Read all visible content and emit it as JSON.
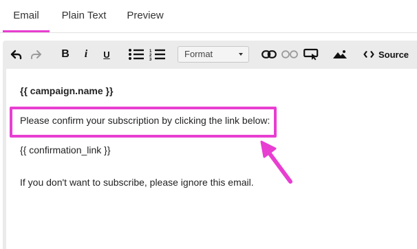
{
  "tabs": [
    {
      "label": "Email",
      "active": true
    },
    {
      "label": "Plain Text",
      "active": false
    },
    {
      "label": "Preview",
      "active": false
    }
  ],
  "toolbar": {
    "undo_icon": "undo-arrow-icon",
    "redo_icon": "redo-arrow-icon",
    "bold_label": "B",
    "italic_label": "i",
    "underline_label": "U",
    "format_label": "Format",
    "source_label": "Source"
  },
  "content": {
    "line1": "{{ campaign.name }}",
    "line2": "Please confirm your subscription by clicking the link below:",
    "line3": "{{ confirmation_link }}",
    "line4": "If you don't want to subscribe, please ignore this email."
  },
  "colors": {
    "accent": "#e83ed1",
    "toolbar_bg": "#ebebeb"
  }
}
